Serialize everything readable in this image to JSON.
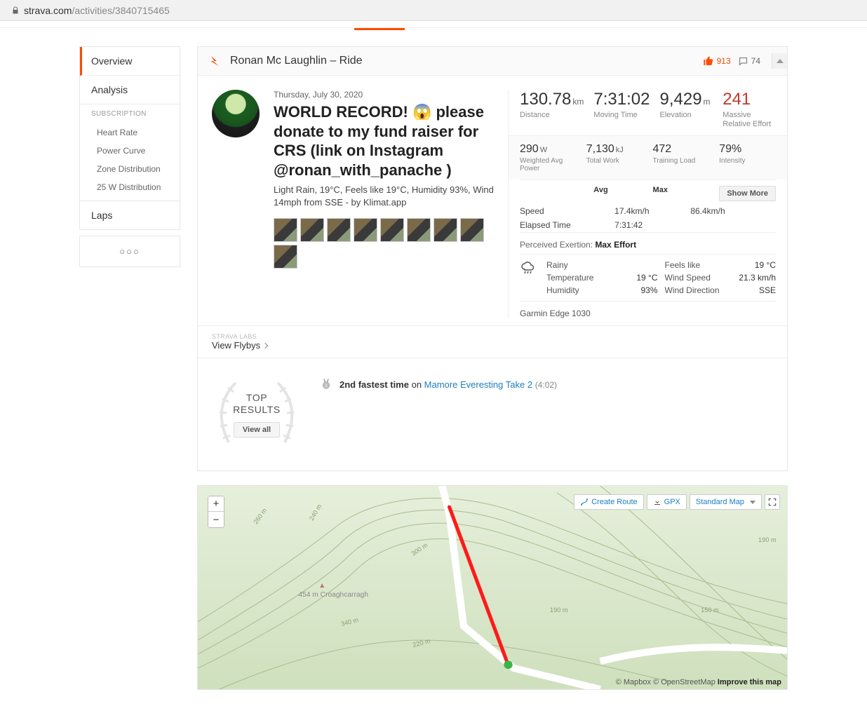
{
  "url": {
    "host": "strava.com",
    "path": "/activities/3840715465"
  },
  "sidebar": {
    "items": [
      "Overview",
      "Analysis"
    ],
    "subscription": "SUBSCRIPTION",
    "subs": [
      "Heart Rate",
      "Power Curve",
      "Zone Distribution",
      "25 W Distribution"
    ],
    "laps": "Laps",
    "more": "○○○"
  },
  "header": {
    "athlete": "Ronan Mc Laughlin",
    "sep": " – ",
    "type": "Ride",
    "kudos": "913",
    "comments": "74"
  },
  "activity": {
    "date": "Thursday, July 30, 2020",
    "title": "WORLD RECORD! 😱 please donate to my fund raiser for CRS (link on Instagram @ronan_with_panache )",
    "weather_line": "Light Rain, 19°C, Feels like 19°C, Humidity 93%, Wind 14mph from SSE - by Klimat.app"
  },
  "stats": {
    "row1": [
      {
        "val": "130.78",
        "unit": "km",
        "lbl": "Distance"
      },
      {
        "val": "7:31:02",
        "unit": "",
        "lbl": "Moving Time"
      },
      {
        "val": "9,429",
        "unit": "m",
        "lbl": "Elevation"
      },
      {
        "val": "241",
        "unit": "",
        "lbl": "Massive Relative Effort",
        "re": true
      }
    ],
    "row2": [
      {
        "val": "290",
        "unit": "W",
        "lbl": "Weighted Avg Power"
      },
      {
        "val": "7,130",
        "unit": "kJ",
        "lbl": "Total Work"
      },
      {
        "val": "472",
        "unit": "",
        "lbl": "Training Load"
      },
      {
        "val": "79%",
        "unit": "",
        "lbl": "Intensity"
      }
    ],
    "tbl": {
      "h1": "",
      "h2": "Avg",
      "h3": "Max",
      "btn": "Show More",
      "rows": [
        {
          "l": "Speed",
          "a": "17.4km/h",
          "m": "86.4km/h"
        },
        {
          "l": "Elapsed Time",
          "a": "7:31:42",
          "m": ""
        }
      ]
    },
    "pe": {
      "label": "Perceived Exertion: ",
      "val": "Max Effort"
    },
    "weather": {
      "c1": [
        "Rainy",
        "Temperature",
        "Humidity"
      ],
      "v1": [
        "",
        "19 °C",
        "93%"
      ],
      "c2": [
        "Feels like",
        "Wind Speed",
        "Wind Direction"
      ],
      "v2": [
        "19 °C",
        "21.3 km/h",
        "SSE"
      ]
    },
    "device": "Garmin Edge 1030"
  },
  "flybys": {
    "brand": "STRAVA LABS",
    "link": "View Flybys"
  },
  "topresults": {
    "label1": "TOP",
    "label2": "RESULTS",
    "btn": "View all",
    "ach": {
      "rank": "2",
      "text": "2nd fastest time",
      "on": " on ",
      "segment": "Mamore Everesting Take 2",
      "time": "(4:02)"
    }
  },
  "map": {
    "create": "Create Route",
    "gpx": "GPX",
    "standard": "Standard Map",
    "attrib_prefix": "© Mapbox © OpenStreetMap ",
    "improve": "Improve this map",
    "peak": "454 m\nCroaghcarragh",
    "elevs": [
      "190 m",
      "240 m",
      "260 m",
      "300 m",
      "340 m",
      "220 m",
      "150 m",
      "190 m"
    ]
  }
}
